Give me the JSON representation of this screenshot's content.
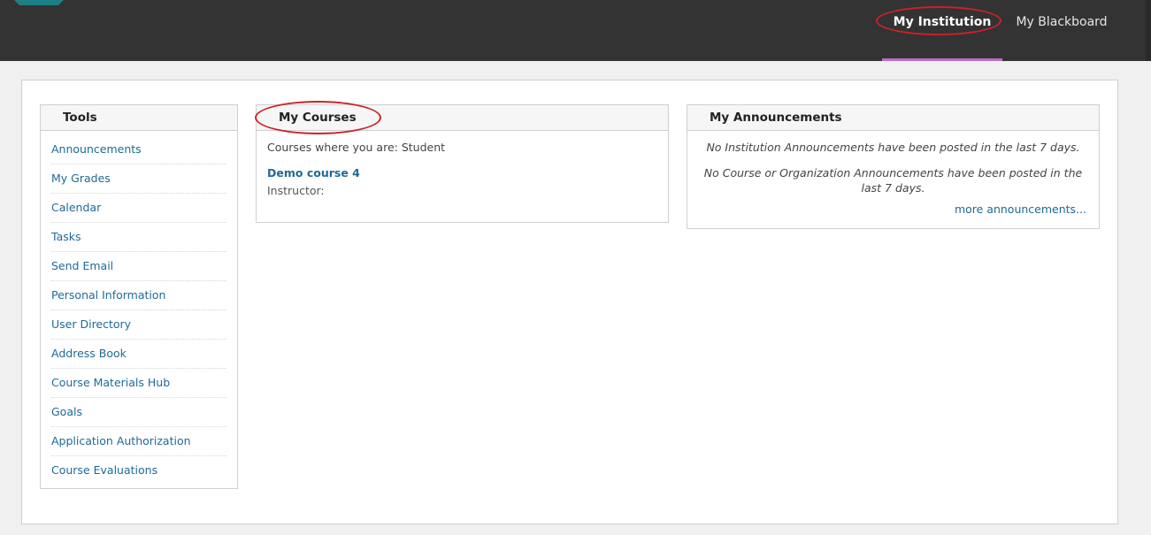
{
  "nav": {
    "tabs": [
      {
        "label": "My Institution",
        "active": true
      },
      {
        "label": "My Blackboard",
        "active": false
      }
    ]
  },
  "colors": {
    "topbar": "#333333",
    "accent": "#b86ec4",
    "link": "#1e6a96",
    "highlight": "#cc2128"
  },
  "tools": {
    "title": "Tools",
    "items": [
      "Announcements",
      "My Grades",
      "Calendar",
      "Tasks",
      "Send Email",
      "Personal Information",
      "User Directory",
      "Address Book",
      "Course Materials Hub",
      "Goals",
      "Application Authorization",
      "Course Evaluations"
    ]
  },
  "courses": {
    "title": "My Courses",
    "role_text": "Courses where you are: Student",
    "course_name": "Demo course 4",
    "instructor_label": "Instructor:"
  },
  "announcements": {
    "title": "My Announcements",
    "institution_text": "No Institution Announcements have been posted in the last 7 days.",
    "course_text": "No Course or Organization Announcements have been posted in the last 7 days.",
    "more_link": "more announcements..."
  }
}
